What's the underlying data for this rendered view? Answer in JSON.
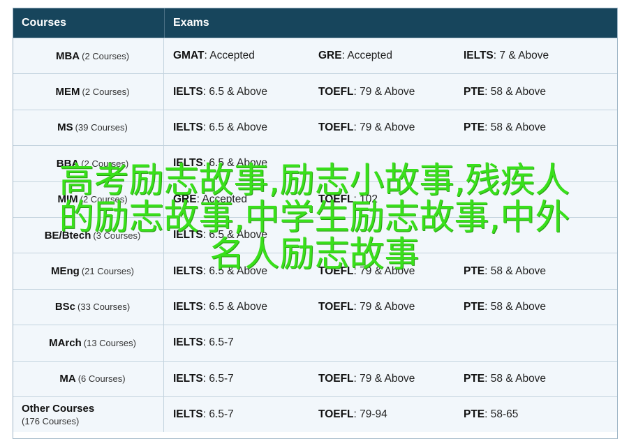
{
  "header": {
    "col1": "Courses",
    "col2": "Exams"
  },
  "rows": [
    {
      "name": "MBA",
      "count": "(2 Courses)",
      "exams": [
        {
          "name": "GMAT",
          "value": ": Accepted"
        },
        {
          "name": "GRE",
          "value": ": Accepted"
        },
        {
          "name": "IELTS",
          "value": ": 7 & Above"
        }
      ]
    },
    {
      "name": "MEM",
      "count": "(2 Courses)",
      "exams": [
        {
          "name": "IELTS",
          "value": ": 6.5 & Above"
        },
        {
          "name": "TOEFL",
          "value": ": 79 & Above"
        },
        {
          "name": "PTE",
          "value": ": 58 & Above"
        }
      ]
    },
    {
      "name": "MS",
      "count": "(39 Courses)",
      "exams": [
        {
          "name": "IELTS",
          "value": ": 6.5 & Above"
        },
        {
          "name": "TOEFL",
          "value": ": 79 & Above"
        },
        {
          "name": "PTE",
          "value": ": 58 & Above"
        }
      ]
    },
    {
      "name": "BBA",
      "count": "(2 Courses)",
      "exams": [
        {
          "name": "IELTS",
          "value": ": 6.5 & Above"
        }
      ]
    },
    {
      "name": "MIM",
      "count": "(2 Courses)",
      "exams": [
        {
          "name": "GRE",
          "value": ": Accepted"
        },
        {
          "name": "TOEFL",
          "value": ": 102"
        }
      ]
    },
    {
      "name": "BE/Btech",
      "count": "(3 Courses)",
      "exams": [
        {
          "name": "IELTS",
          "value": ": 6.5 & Above"
        }
      ]
    },
    {
      "name": "MEng",
      "count": "(21 Courses)",
      "exams": [
        {
          "name": "IELTS",
          "value": ": 6.5 & Above"
        },
        {
          "name": "TOEFL",
          "value": ": 79 & Above"
        },
        {
          "name": "PTE",
          "value": ": 58 & Above"
        }
      ]
    },
    {
      "name": "BSc",
      "count": "(33 Courses)",
      "exams": [
        {
          "name": "IELTS",
          "value": ": 6.5 & Above"
        },
        {
          "name": "TOEFL",
          "value": ": 79 & Above"
        },
        {
          "name": "PTE",
          "value": ": 58 & Above"
        }
      ]
    },
    {
      "name": "MArch",
      "count": "(13 Courses)",
      "exams": [
        {
          "name": "IELTS",
          "value": ": 6.5-7"
        }
      ]
    },
    {
      "name": "MA",
      "count": "(6 Courses)",
      "exams": [
        {
          "name": "IELTS",
          "value": ": 6.5-7"
        },
        {
          "name": "TOEFL",
          "value": ": 79 & Above"
        },
        {
          "name": "PTE",
          "value": ": 58 & Above"
        }
      ]
    },
    {
      "name": "Other Courses",
      "count": "(176 Courses)",
      "stacked": true,
      "exams": [
        {
          "name": "IELTS",
          "value": ": 6.5-7"
        },
        {
          "name": "TOEFL",
          "value": ": 79-94"
        },
        {
          "name": "PTE",
          "value": ": 58-65"
        }
      ]
    }
  ],
  "overlay": {
    "line1": "高考励志故事,励志小故事,残疾人",
    "line2": "的励志故事,中学生励志故事,中外",
    "line3": "名人励志故事"
  }
}
